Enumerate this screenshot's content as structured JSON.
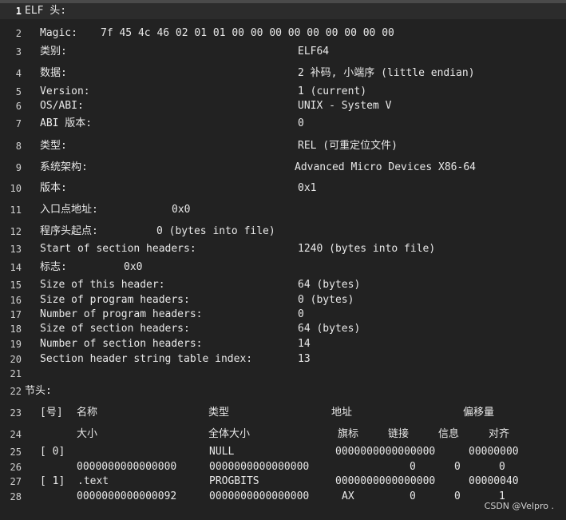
{
  "lines": [
    {
      "num": "1",
      "segs": [
        "ELF 头:"
      ]
    },
    {
      "num": "2",
      "segs": [
        "Magic:",
        "7f 45 4c 46 02 01 01 00 00 00 00 00 00 00 00 00"
      ]
    },
    {
      "num": "3",
      "segs": [
        "类别:",
        "ELF64"
      ]
    },
    {
      "num": "4",
      "segs": [
        "数据:",
        "2 补码, 小端序 (little endian)"
      ]
    },
    {
      "num": "5",
      "segs": [
        "Version:",
        "1 (current)"
      ]
    },
    {
      "num": "6",
      "segs": [
        "OS/ABI:",
        "UNIX - System V"
      ]
    },
    {
      "num": "7",
      "segs": [
        "ABI 版本:",
        "0"
      ]
    },
    {
      "num": "8",
      "segs": [
        "类型:",
        "REL (可重定位文件)"
      ]
    },
    {
      "num": "9",
      "segs": [
        "系统架构:",
        "Advanced Micro Devices X86-64"
      ]
    },
    {
      "num": "10",
      "segs": [
        "版本:",
        "0x1"
      ]
    },
    {
      "num": "11",
      "segs": [
        "入口点地址:",
        "0x0"
      ]
    },
    {
      "num": "12",
      "segs": [
        "程序头起点:",
        "0 (bytes into file)"
      ]
    },
    {
      "num": "13",
      "segs": [
        "Start of section headers:",
        "1240 (bytes into file)"
      ]
    },
    {
      "num": "14",
      "segs": [
        "标志:",
        "0x0"
      ]
    },
    {
      "num": "15",
      "segs": [
        "Size of this header:",
        "64 (bytes)"
      ]
    },
    {
      "num": "16",
      "segs": [
        "Size of program headers:",
        "0 (bytes)"
      ]
    },
    {
      "num": "17",
      "segs": [
        "Number of program headers:",
        "0"
      ]
    },
    {
      "num": "18",
      "segs": [
        "Size of section headers:",
        "64 (bytes)"
      ]
    },
    {
      "num": "19",
      "segs": [
        "Number of section headers:",
        "14"
      ]
    },
    {
      "num": "20",
      "segs": [
        "Section header string table index:",
        "13"
      ]
    },
    {
      "num": "21",
      "segs": []
    },
    {
      "num": "22",
      "segs": [
        "节头:"
      ]
    },
    {
      "num": "23",
      "segs": [
        "[号]",
        "名称",
        "类型",
        "地址",
        "偏移量"
      ]
    },
    {
      "num": "24",
      "segs": [
        "大小",
        "全体大小",
        "旗标",
        "链接",
        "信息",
        "对齐"
      ]
    },
    {
      "num": "25",
      "segs": [
        "[ 0]",
        "NULL",
        "0000000000000000",
        "00000000"
      ]
    },
    {
      "num": "26",
      "segs": [
        "0000000000000000",
        "0000000000000000",
        "0",
        "0",
        "0"
      ]
    },
    {
      "num": "27",
      "segs": [
        "[ 1]",
        ".text",
        "PROGBITS",
        "0000000000000000",
        "00000040"
      ]
    },
    {
      "num": "28",
      "segs": [
        "0000000000000092",
        "0000000000000000",
        "AX",
        "0",
        "0",
        "1"
      ]
    }
  ],
  "watermark": "CSDN @Velpro ."
}
